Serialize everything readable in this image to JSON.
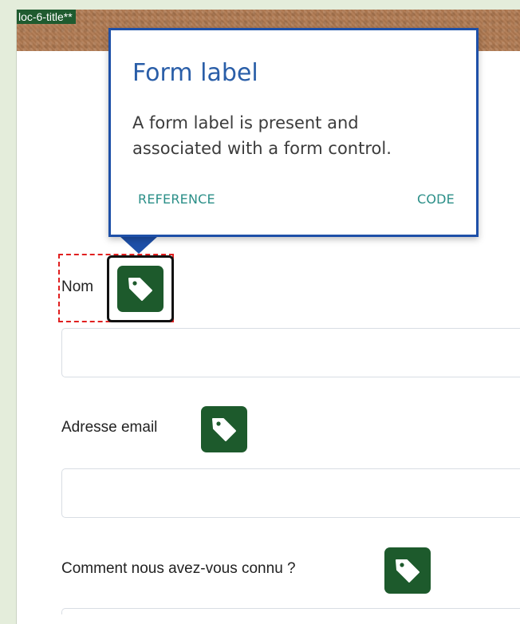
{
  "banner": {
    "tag": "loc-6-title**"
  },
  "popover": {
    "title": "Form label",
    "description": "A form label is present and associated with a form control.",
    "reference_label": "REFERENCE",
    "code_label": "CODE"
  },
  "fields": [
    {
      "label": "Nom",
      "value": ""
    },
    {
      "label": "Adresse email",
      "value": ""
    },
    {
      "label": "Comment nous avez-vous connu ?",
      "value": ""
    }
  ],
  "colors": {
    "popover_border": "#1e50a8",
    "popover_title": "#2a5ea8",
    "link": "#2b8f88",
    "tag_button": "#1d5a2c",
    "highlight": "#e02020"
  },
  "icons": {
    "tag": "tag-icon"
  }
}
